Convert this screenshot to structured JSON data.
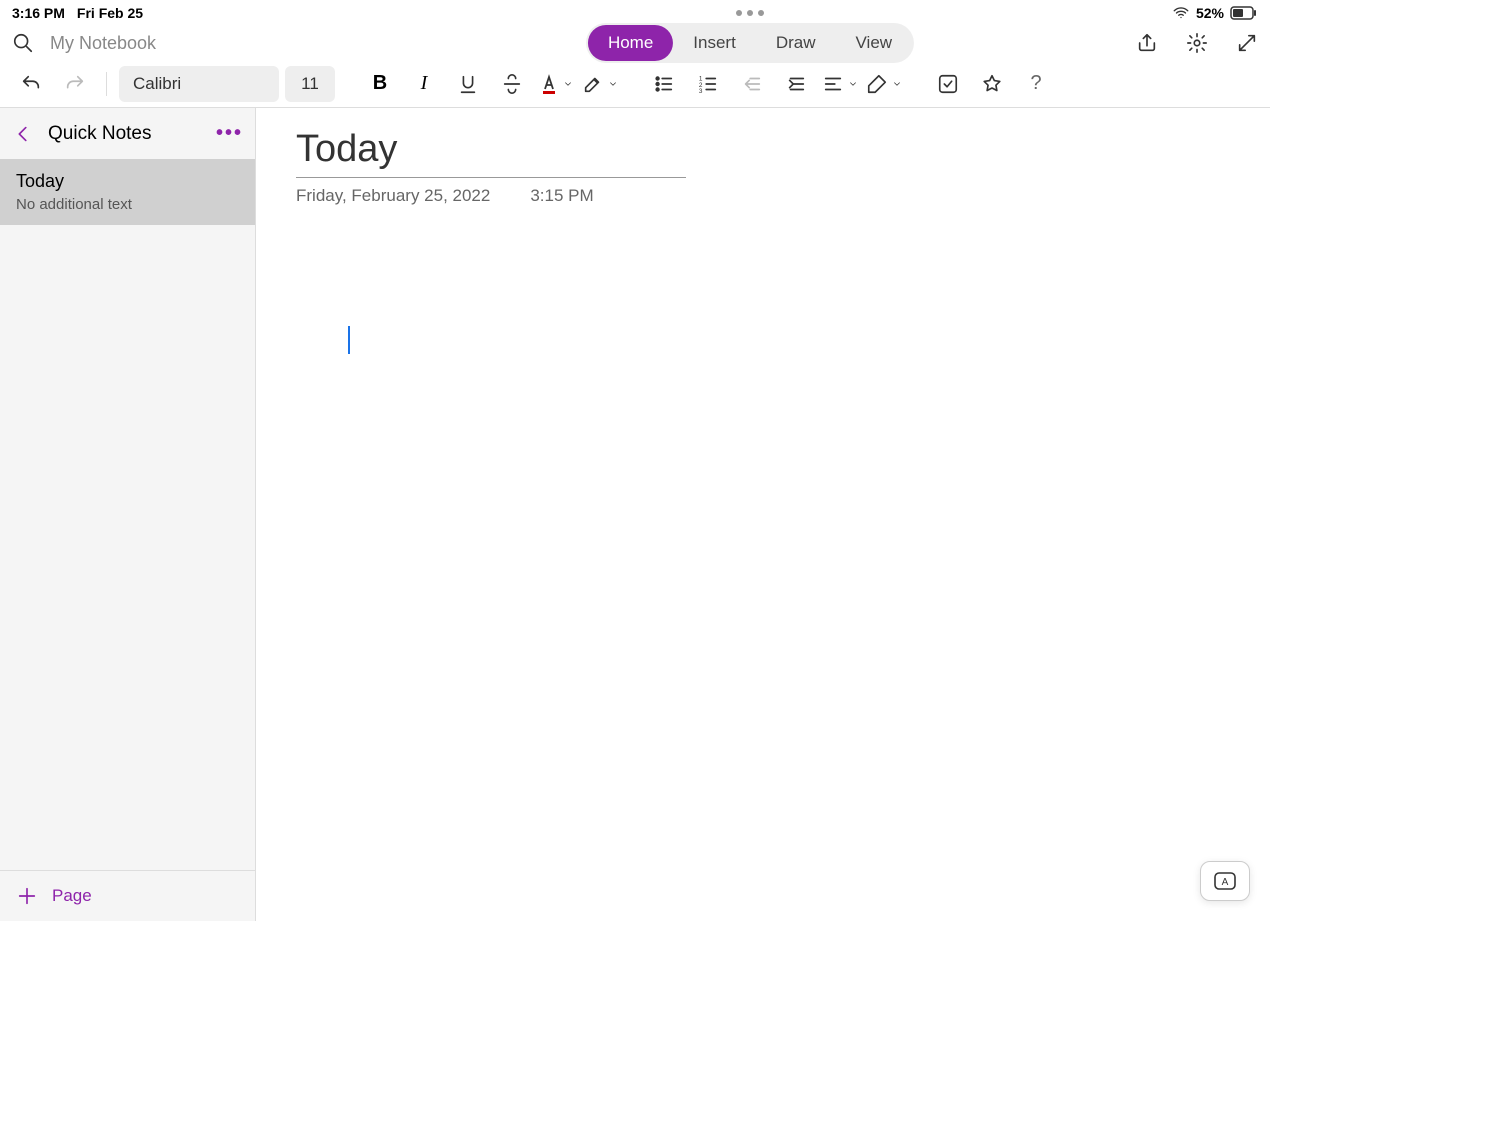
{
  "status": {
    "time": "3:16 PM",
    "date": "Fri Feb 25",
    "battery": "52%"
  },
  "header": {
    "notebook": "My Notebook",
    "tabs": {
      "home": "Home",
      "insert": "Insert",
      "draw": "Draw",
      "view": "View"
    }
  },
  "toolbar": {
    "font_name": "Calibri",
    "font_size": "11"
  },
  "sidebar": {
    "section": "Quick Notes",
    "note": {
      "title": "Today",
      "subtitle": "No additional text"
    },
    "add_page": "Page"
  },
  "page": {
    "title": "Today",
    "date": "Friday, February 25, 2022",
    "time": "3:15 PM"
  },
  "keyboard_mode": "A"
}
